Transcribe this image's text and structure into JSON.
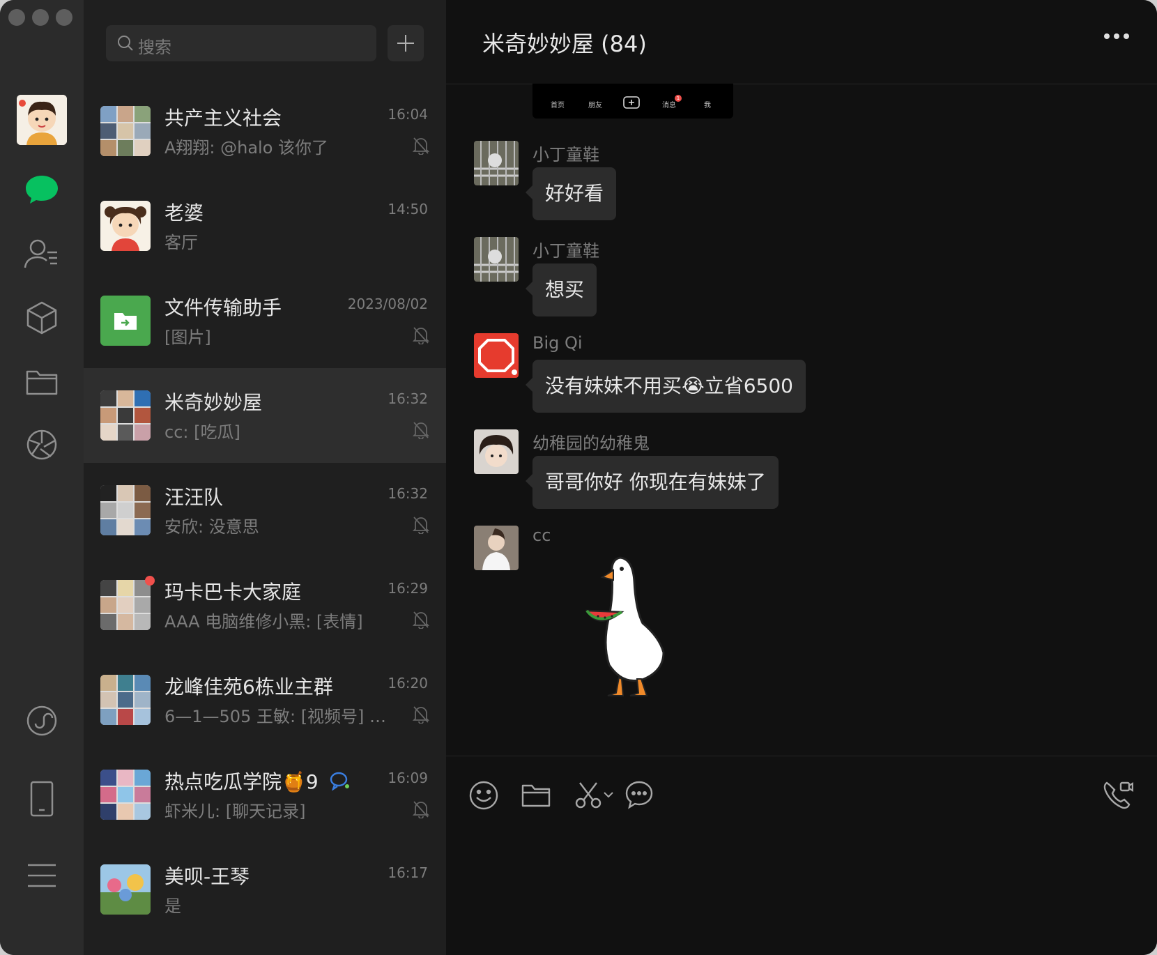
{
  "search": {
    "placeholder": "搜索"
  },
  "sessions": [
    {
      "name": "共产主义社会",
      "time": "16:04",
      "preview": "A翔翔: @halo 该你了"
    },
    {
      "name": "老婆",
      "time": "14:50",
      "preview": "客厅"
    },
    {
      "name": "文件传输助手",
      "time": "2023/08/02",
      "preview": "[图片]"
    },
    {
      "name": "米奇妙妙屋",
      "time": "16:32",
      "preview": "cc: [吃瓜]"
    },
    {
      "name": "汪汪队",
      "time": "16:32",
      "preview": "安欣: 没意思"
    },
    {
      "name": "玛卡巴卡大家庭",
      "time": "16:29",
      "preview": "AAA 电脑维修小黑: [表情]"
    },
    {
      "name": "龙峰佳苑6栋业主群",
      "time": "16:20",
      "preview": "6—1—505 王敏: [视频号] 独…"
    },
    {
      "name": "热点吃瓜学院🍯9",
      "time": "16:09",
      "preview": "虾米儿: [聊天记录]"
    },
    {
      "name": "美呗-王琴",
      "time": "16:17",
      "preview": "是"
    }
  ],
  "chat": {
    "title": "米奇妙妙屋 (84)",
    "image_tabs": [
      "首页",
      "朋友",
      "消息",
      "我"
    ],
    "image_badge": "1",
    "messages": [
      {
        "sender": "小丁童鞋",
        "text": "好好看"
      },
      {
        "sender": "小丁童鞋",
        "text": "想买"
      },
      {
        "sender": "Big Qi",
        "text": "没有妹妹不用买😭立省6500"
      },
      {
        "sender": "幼稚园的幼稚鬼",
        "text": "哥哥你好  你现在有妹妹了"
      },
      {
        "sender": "cc",
        "text": ""
      }
    ]
  },
  "colors": {
    "accent": "#07c160",
    "unread": "#f0504c",
    "file_helper": "#4aa84e"
  }
}
